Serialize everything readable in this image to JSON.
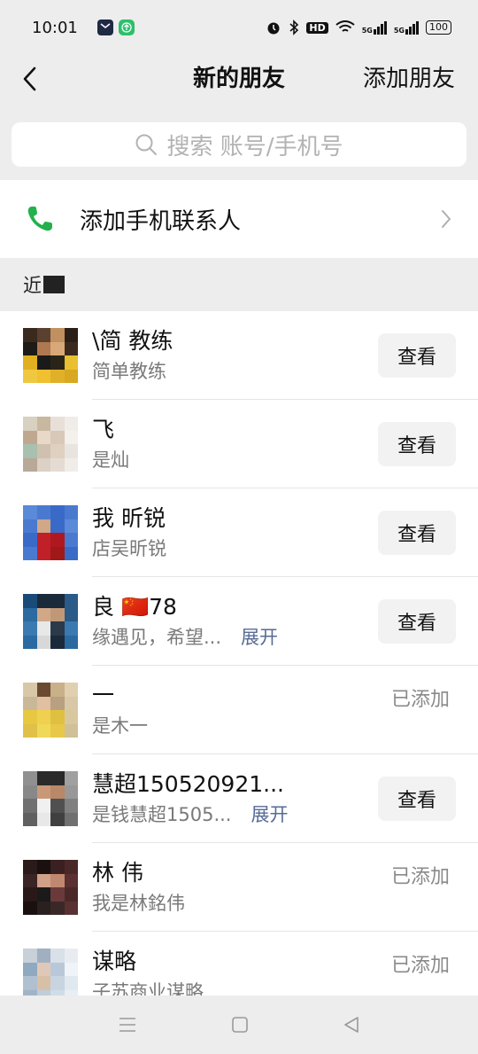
{
  "status_bar": {
    "time": "10:01",
    "network": "5G",
    "hd": "HD",
    "battery": "100"
  },
  "nav": {
    "title": "新的朋友",
    "action": "添加朋友"
  },
  "search": {
    "placeholder": "搜索 账号/手机号"
  },
  "add_contact": {
    "label": "添加手机联系人"
  },
  "section": {
    "label": "近"
  },
  "requests": [
    {
      "name": "\\简 教练",
      "message": "简单教练",
      "action": "查看",
      "status": "",
      "expand": ""
    },
    {
      "name": "飞",
      "message": "是灿",
      "action": "查看",
      "status": "",
      "expand": ""
    },
    {
      "name": "我 昕锐",
      "message": "店吴昕锐",
      "action": "查看",
      "status": "",
      "expand": ""
    },
    {
      "name": "良 🇨🇳78",
      "message": "缘遇见，希望...",
      "action": "查看",
      "status": "",
      "expand": "展开"
    },
    {
      "name": "一",
      "message": "是木一",
      "action": "",
      "status": "已添加",
      "expand": ""
    },
    {
      "name": "慧超150520921...",
      "message": "是钱慧超1505...",
      "action": "查看",
      "status": "",
      "expand": "展开"
    },
    {
      "name": "林 伟",
      "message": "我是林銘伟",
      "action": "",
      "status": "已添加",
      "expand": ""
    },
    {
      "name": "谋略",
      "message": "子苏商业谋略",
      "action": "",
      "status": "已添加",
      "expand": ""
    }
  ],
  "colors": {
    "accent_link": "#576b95",
    "phone_green": "#22b14c",
    "background": "#ededed"
  }
}
